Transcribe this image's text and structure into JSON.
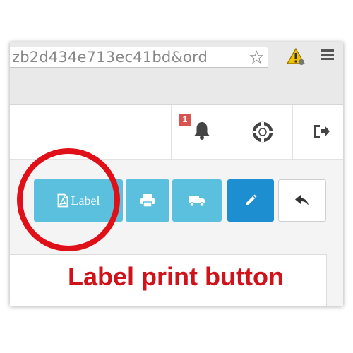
{
  "browser": {
    "url": "zb2d434e713ec41bd&ord",
    "bookmark_icon": "star-icon",
    "extension_icon": "warning-extension-icon",
    "menu_icon": "hamburger-menu-icon"
  },
  "header": {
    "notifications": {
      "icon": "bell-icon",
      "badge_count": "1"
    },
    "help_icon": "life-ring-icon",
    "logout_icon": "sign-out-icon"
  },
  "toolbar": {
    "label_button": {
      "icon": "pdf-file-icon",
      "text": "Label"
    },
    "print_button": {
      "icon": "printer-icon"
    },
    "ship_button": {
      "icon": "truck-icon"
    },
    "edit_button": {
      "icon": "pencil-icon"
    },
    "back_button": {
      "icon": "reply-arrow-icon"
    }
  },
  "annotation": {
    "caption": "Label print button",
    "highlight_color": "#e01019"
  },
  "colors": {
    "info": "#5bc0de",
    "primary": "#1d8fd0",
    "badge": "#d9534f",
    "caption": "#d0121b"
  }
}
